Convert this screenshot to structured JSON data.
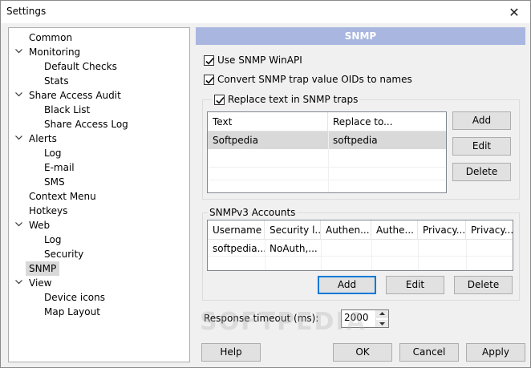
{
  "window": {
    "title": "Settings",
    "close_glyph": "✕"
  },
  "tree": [
    {
      "label": "Common",
      "level": 0,
      "expandable": false
    },
    {
      "label": "Monitoring",
      "level": 0,
      "expandable": true
    },
    {
      "label": "Default Checks",
      "level": 1,
      "expandable": false
    },
    {
      "label": "Stats",
      "level": 1,
      "expandable": false
    },
    {
      "label": "Share Access Audit",
      "level": 0,
      "expandable": true
    },
    {
      "label": "Black List",
      "level": 1,
      "expandable": false
    },
    {
      "label": "Share Access Log",
      "level": 1,
      "expandable": false
    },
    {
      "label": "Alerts",
      "level": 0,
      "expandable": true
    },
    {
      "label": "Log",
      "level": 1,
      "expandable": false
    },
    {
      "label": "E-mail",
      "level": 1,
      "expandable": false
    },
    {
      "label": "SMS",
      "level": 1,
      "expandable": false
    },
    {
      "label": "Context Menu",
      "level": 0,
      "expandable": false
    },
    {
      "label": "Hotkeys",
      "level": 0,
      "expandable": false
    },
    {
      "label": "Web",
      "level": 0,
      "expandable": true
    },
    {
      "label": "Log",
      "level": 1,
      "expandable": false
    },
    {
      "label": "Security",
      "level": 1,
      "expandable": false
    },
    {
      "label": "SNMP",
      "level": 0,
      "expandable": false,
      "selected": true
    },
    {
      "label": "View",
      "level": 0,
      "expandable": true
    },
    {
      "label": "Device icons",
      "level": 1,
      "expandable": false
    },
    {
      "label": "Map Layout",
      "level": 1,
      "expandable": false
    }
  ],
  "panel": {
    "header": "SNMP",
    "use_winapi": {
      "label": "Use SNMP WinAPI",
      "checked": true
    },
    "convert_oids": {
      "label": "Convert SNMP trap value OIDs to names",
      "checked": true
    },
    "replace_text": {
      "label": "Replace text in SNMP traps",
      "checked": true
    },
    "replace_table": {
      "columns": [
        "Text",
        "Replace to..."
      ],
      "rows": [
        [
          "Softpedia",
          "softpedia"
        ]
      ]
    },
    "replace_buttons": {
      "add": "Add",
      "edit": "Edit",
      "delete": "Delete"
    },
    "snmpv3": {
      "legend": "SNMPv3 Accounts",
      "columns": [
        "Username",
        "Security l...",
        "Authen...",
        "Authe...",
        "Privacy...",
        "Privacy..."
      ],
      "rows": [
        [
          "softpedia...",
          "NoAuth,...",
          "",
          "",
          "",
          ""
        ]
      ],
      "buttons": {
        "add": "Add",
        "edit": "Edit",
        "delete": "Delete"
      }
    },
    "timeout": {
      "label": "Response timeout (ms):",
      "value": "2000"
    }
  },
  "footer": {
    "help": "Help",
    "ok": "OK",
    "cancel": "Cancel",
    "apply": "Apply"
  },
  "watermark": "SOFTPEDIA",
  "colors": {
    "header_bar": "#a9b7e0",
    "focus": "#0078d7",
    "selection": "#d9d9d9"
  }
}
